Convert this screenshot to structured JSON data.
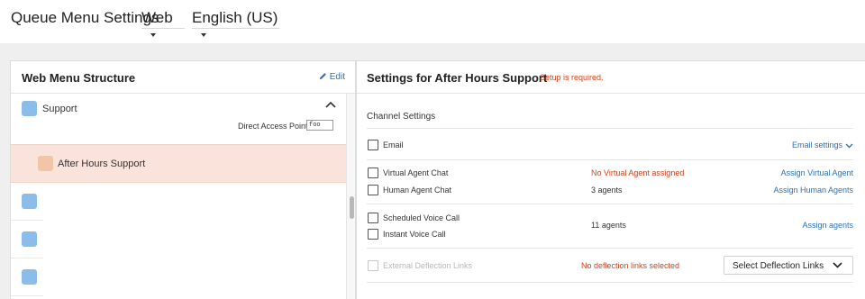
{
  "header": {
    "title": "Queue Menu Settings",
    "channel_select": "Web",
    "language_select": "English (US)"
  },
  "left_panel": {
    "title": "Web Menu Structure",
    "edit_label": "Edit",
    "support_label": "Support",
    "direct_access_label": "Direct Access Point",
    "direct_access_value": "foo",
    "selected_item_label": "After Hours Support"
  },
  "right_panel": {
    "title": "Settings for After Hours Support",
    "warning": "Setup is required.",
    "channel_settings_title": "Channel Settings",
    "email": {
      "label": "Email",
      "link": "Email settings"
    },
    "virtual_agent_chat": {
      "label": "Virtual Agent Chat",
      "status": "No Virtual Agent assigned",
      "link": "Assign Virtual Agent"
    },
    "human_agent_chat": {
      "label": "Human Agent Chat",
      "status": "3 agents",
      "link": "Assign Human Agents"
    },
    "scheduled_voice_call": {
      "label": "Scheduled Voice Call"
    },
    "instant_voice_call": {
      "label": "Instant Voice Call"
    },
    "voice_status": "11 agents",
    "voice_link": "Assign agents",
    "deflection": {
      "label": "External Deflection Links",
      "status": "No deflection links selected",
      "button": "Select Deflection Links"
    }
  },
  "colors": {
    "accent_link": "#2f6fb7",
    "warning": "#d1431f",
    "selected_row": "#fae3da",
    "node_blue": "#8cbde8",
    "node_peach": "#f2c4a8"
  }
}
